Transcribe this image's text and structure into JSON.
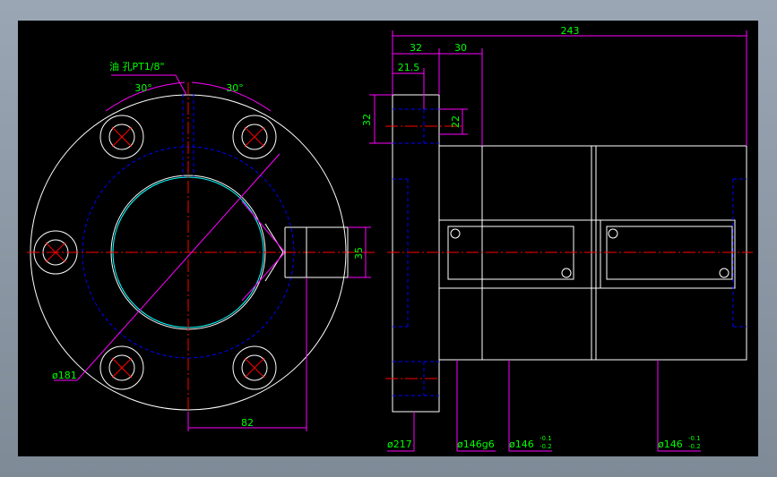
{
  "labels": {
    "oil_hole": "油 孔PT1/8\"",
    "angle_left": "30°",
    "angle_right": "30°",
    "dia_181": "ø181",
    "dim_82": "82",
    "dim_35": "35",
    "dim_243": "243",
    "dim_32_top": "32",
    "dim_30": "30",
    "dim_21_5": "21.5",
    "dim_32_left": "32",
    "dim_22": "22",
    "dia_217": "ø217",
    "dia_146g6": "ø146g6",
    "dia_146_a": "ø146",
    "tol_a_upper": "-0.1",
    "tol_a_lower": "-0.2",
    "dia_146_b": "ø146",
    "tol_b_upper": "-0.1",
    "tol_b_lower": "-0.2"
  },
  "colors": {
    "background": "#000000",
    "outline": "#ffffff",
    "hidden": "#0000ff",
    "center": "#ff0000",
    "dimension": "#ff00ff",
    "text": "#00ff00"
  }
}
